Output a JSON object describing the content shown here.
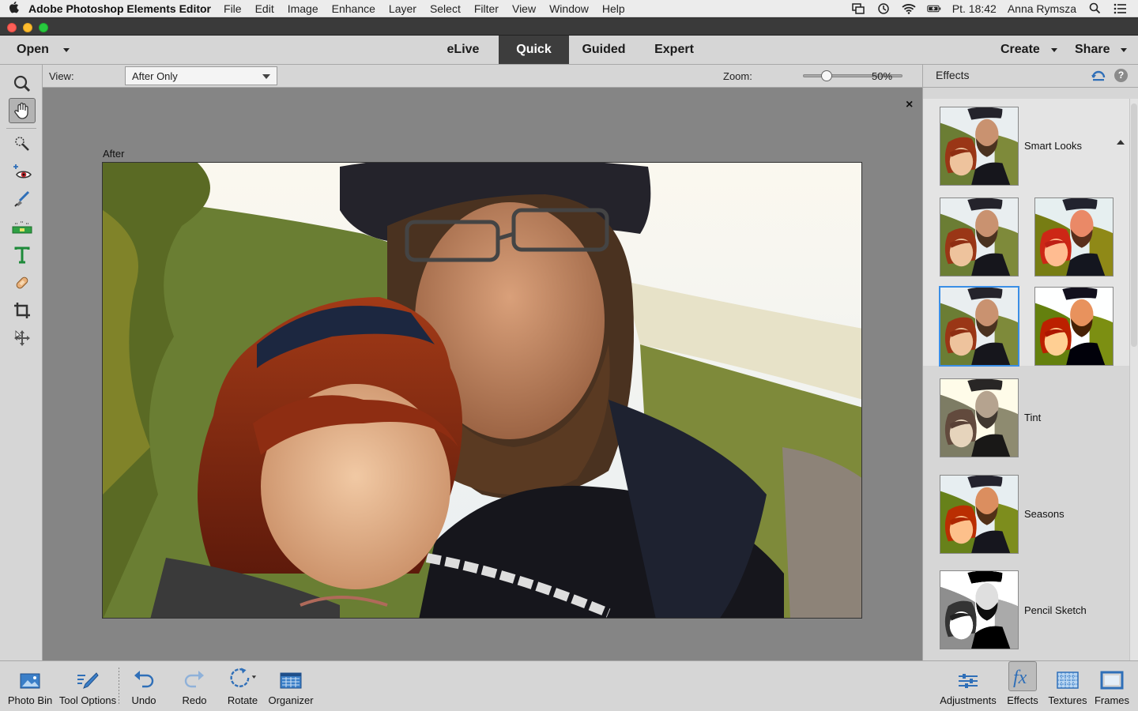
{
  "menubar": {
    "app_name": "Adobe Photoshop Elements Editor",
    "items": [
      "File",
      "Edit",
      "Image",
      "Enhance",
      "Layer",
      "Select",
      "Filter",
      "View",
      "Window",
      "Help"
    ],
    "clock": "Pt. 18:42",
    "user": "Anna Rymsza"
  },
  "toolbar": {
    "open_label": "Open",
    "tabs": [
      {
        "label": "eLive",
        "active": false
      },
      {
        "label": "Quick",
        "active": true
      },
      {
        "label": "Guided",
        "active": false
      },
      {
        "label": "Expert",
        "active": false
      }
    ],
    "create_label": "Create",
    "share_label": "Share"
  },
  "tools": [
    {
      "name": "zoom-tool",
      "icon": "magnifier-icon",
      "selected": false
    },
    {
      "name": "hand-tool",
      "icon": "hand-icon",
      "selected": true
    },
    {
      "name": "quick-selection-tool",
      "icon": "magic-wand-icon",
      "selected": false
    },
    {
      "name": "red-eye-tool",
      "icon": "eye-icon",
      "selected": false
    },
    {
      "name": "whiten-teeth-tool",
      "icon": "brush-icon",
      "selected": false
    },
    {
      "name": "straighten-tool",
      "icon": "level-icon",
      "selected": false
    },
    {
      "name": "type-tool",
      "icon": "type-icon",
      "selected": false
    },
    {
      "name": "spot-healing-tool",
      "icon": "bandage-icon",
      "selected": false
    },
    {
      "name": "crop-tool",
      "icon": "crop-icon",
      "selected": false
    },
    {
      "name": "move-tool",
      "icon": "move-icon",
      "selected": false
    }
  ],
  "options": {
    "view_label": "View:",
    "view_value": "After Only",
    "zoom_label": "Zoom:",
    "zoom_value": "50%",
    "zoom_fraction": 0.2
  },
  "canvas": {
    "after_label": "After",
    "close_glyph": "×"
  },
  "effects_panel": {
    "title": "Effects",
    "categories": [
      {
        "label": "Smart Looks"
      },
      {
        "label": "Tint"
      },
      {
        "label": "Seasons"
      },
      {
        "label": "Pencil Sketch"
      }
    ]
  },
  "bottombar": {
    "left": [
      {
        "label": "Photo Bin",
        "icon": "photo-bin-icon"
      },
      {
        "label": "Tool Options",
        "icon": "tool-options-icon"
      },
      {
        "label": "Undo",
        "icon": "undo-icon"
      },
      {
        "label": "Redo",
        "icon": "redo-icon"
      },
      {
        "label": "Rotate",
        "icon": "rotate-icon"
      },
      {
        "label": "Organizer",
        "icon": "organizer-icon"
      }
    ],
    "right": [
      {
        "label": "Adjustments",
        "icon": "adjustments-icon",
        "active": false
      },
      {
        "label": "Effects",
        "icon": "effects-fx-icon",
        "active": true
      },
      {
        "label": "Textures",
        "icon": "textures-icon",
        "active": false
      },
      {
        "label": "Frames",
        "icon": "frames-icon",
        "active": false
      }
    ]
  },
  "colors": {
    "accent": "#3a8ee6",
    "icon_blue": "#2f6fb8",
    "active_tab": "#3d3d3d"
  }
}
